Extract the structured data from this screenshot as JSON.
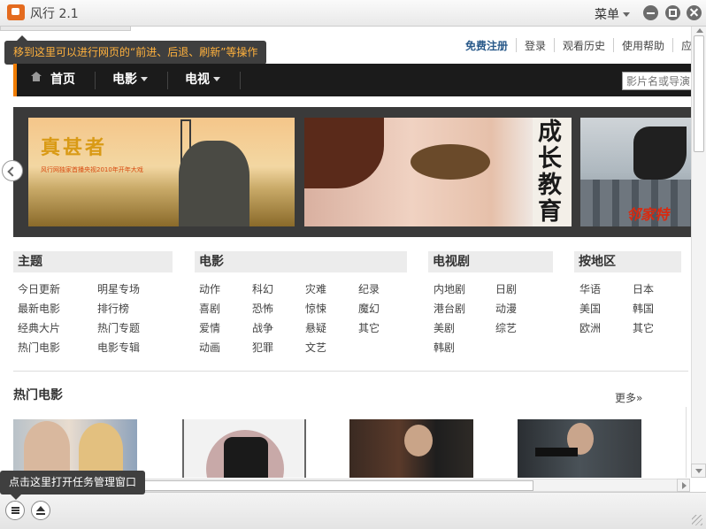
{
  "app": {
    "name": "风行 2.1",
    "menu_label": "菜单"
  },
  "tooltip_top": "移到这里可以进行网页的“前进、后退、刷新”等操作",
  "top_links": [
    "免费注册",
    "登录",
    "观看历史",
    "使用帮助",
    "应"
  ],
  "nav": {
    "home": "首页",
    "movies": "电影",
    "tv": "电视",
    "search_placeholder": "影片名或导演"
  },
  "banner": {
    "slide1_title": "真甚者",
    "slide1_sub": "风行网独家首播央视2010年开年大戏",
    "slide2_title": "成长教育",
    "slide3_title": "邻家特"
  },
  "categories": {
    "theme": {
      "title": "主题",
      "items": [
        "今日更新",
        "明星专场",
        "最新电影",
        "排行榜",
        "经典大片",
        "热门专题",
        "热门电影",
        "电影专辑"
      ]
    },
    "movie": {
      "title": "电影",
      "items": [
        "动作",
        "科幻",
        "灾难",
        "纪录",
        "喜剧",
        "恐怖",
        "惊悚",
        "魔幻",
        "爱情",
        "战争",
        "悬疑",
        "其它",
        "动画",
        "犯罪",
        "文艺"
      ]
    },
    "tvshow": {
      "title": "电视剧",
      "items": [
        "内地剧",
        "日剧",
        "港台剧",
        "动漫",
        "美剧",
        "综艺",
        "韩剧"
      ]
    },
    "region": {
      "title": "按地区",
      "items": [
        "华语",
        "日本",
        "美国",
        "韩国",
        "欧洲",
        "其它"
      ]
    }
  },
  "hot": {
    "title": "热门电影",
    "more": "更多»"
  },
  "tooltip_bottom": "点击这里打开任务管理窗口",
  "colors": {
    "accent": "#f07c00",
    "nav_bg": "#1b1b1b",
    "tooltip_bg": "#3f3f3f",
    "tooltip_text": "#ffb13d"
  }
}
